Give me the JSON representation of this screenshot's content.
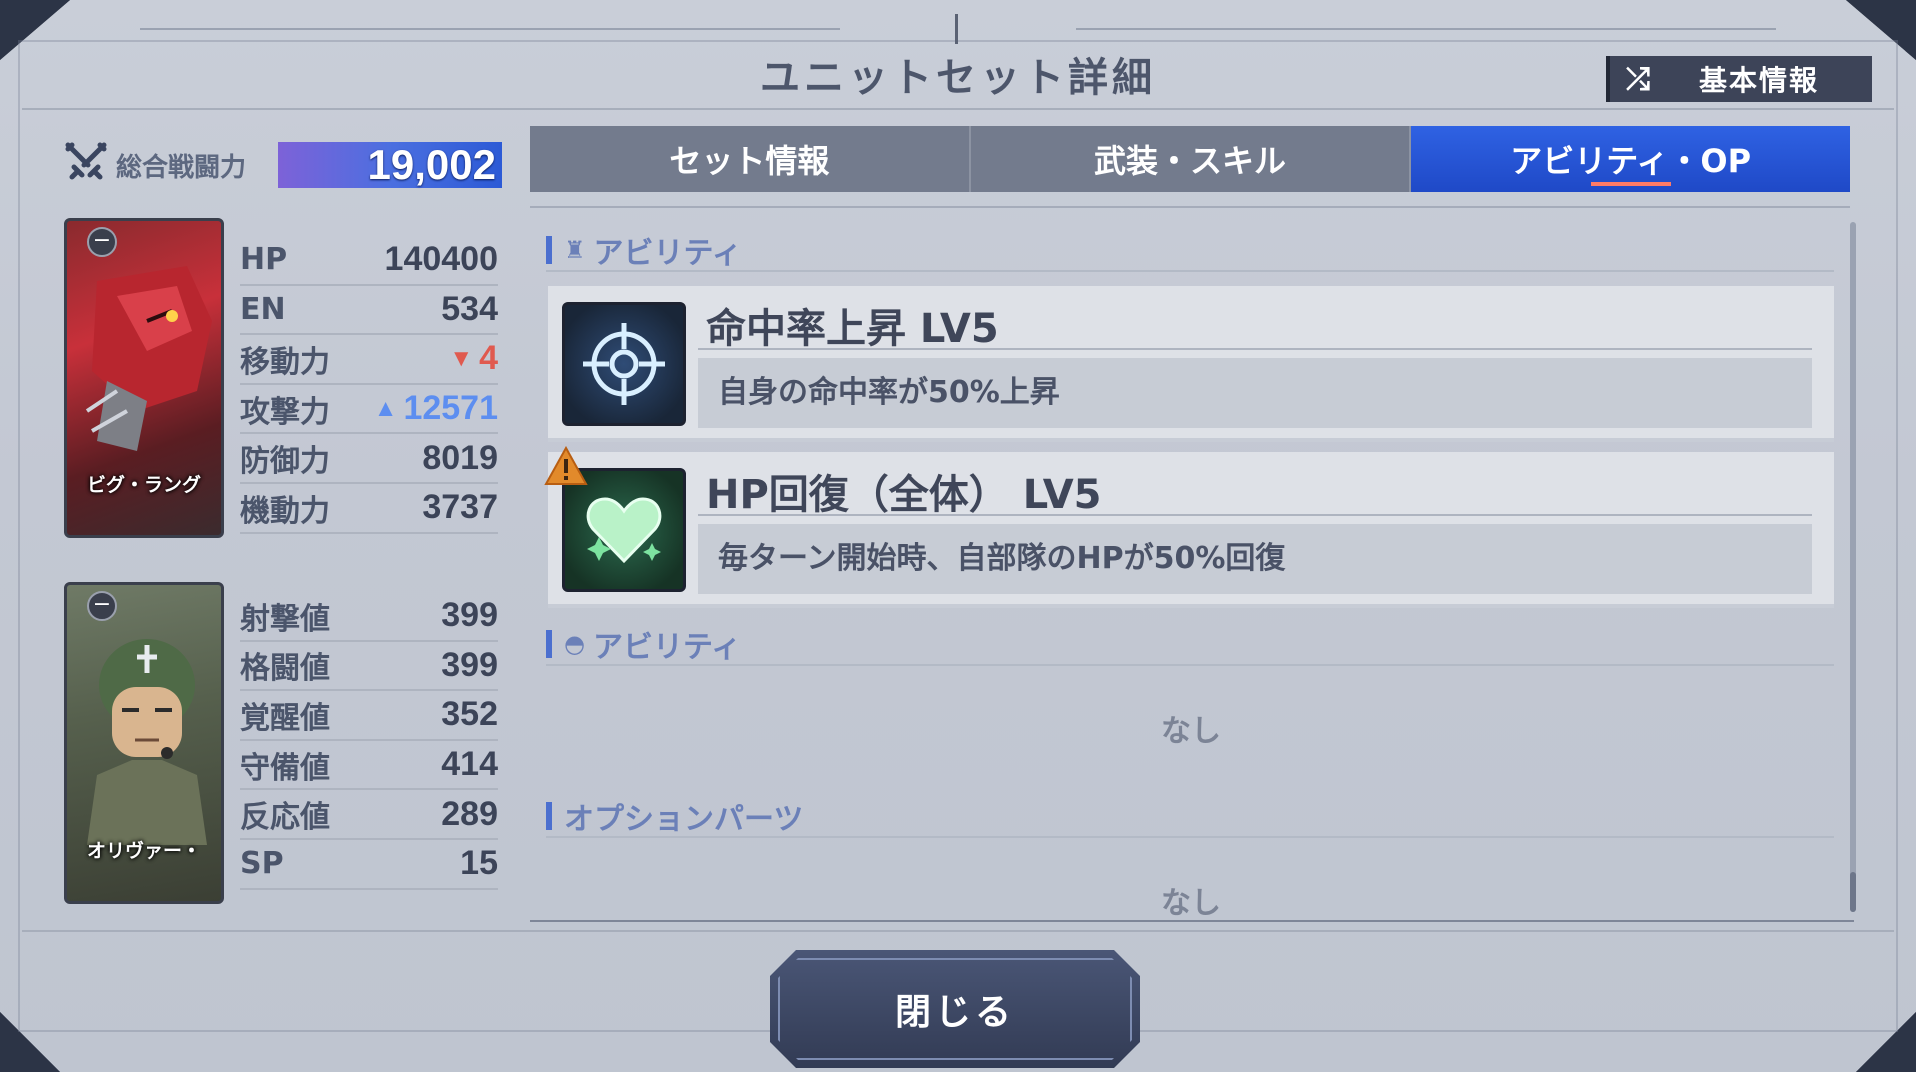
{
  "header": {
    "title": "ユニットセット詳細",
    "basic_info_label": "基本情報"
  },
  "power": {
    "label": "総合戦闘力",
    "value": "19,002"
  },
  "unit": {
    "name": "ビグ・ラング",
    "stats": [
      {
        "label": "HP",
        "value": "140400",
        "trend": "none"
      },
      {
        "label": "EN",
        "value": "534",
        "trend": "none"
      },
      {
        "label": "移動力",
        "value": "4",
        "trend": "down"
      },
      {
        "label": "攻撃力",
        "value": "12571",
        "trend": "up"
      },
      {
        "label": "防御力",
        "value": "8019",
        "trend": "none"
      },
      {
        "label": "機動力",
        "value": "3737",
        "trend": "none"
      }
    ]
  },
  "pilot": {
    "name": "オリヴァー・",
    "stats": [
      {
        "label": "射撃値",
        "value": "399"
      },
      {
        "label": "格闘値",
        "value": "399"
      },
      {
        "label": "覚醒値",
        "value": "352"
      },
      {
        "label": "守備値",
        "value": "414"
      },
      {
        "label": "反応値",
        "value": "289"
      },
      {
        "label": "SP",
        "value": "15"
      }
    ]
  },
  "tabs": [
    {
      "label": "セット情報",
      "active": false
    },
    {
      "label": "武装・スキル",
      "active": false
    },
    {
      "label": "アビリティ・OP",
      "active": true
    }
  ],
  "sections": {
    "unit_ability": {
      "title": "アビリティ",
      "items": [
        {
          "name": "命中率上昇 LV5",
          "desc": "自身の命中率が50%上昇",
          "icon": "crosshair-icon"
        },
        {
          "name": "HP回復（全体） LV5",
          "desc": "毎ターン開始時、自部隊のHPが50%回復",
          "icon": "heart-icon"
        }
      ]
    },
    "pilot_ability": {
      "title": "アビリティ",
      "none": "なし"
    },
    "option_parts": {
      "title": "オプションパーツ",
      "none": "なし"
    }
  },
  "footer": {
    "close_label": "閉じる"
  },
  "colors": {
    "accent_blue": "#2f62e3",
    "stat_down": "#e05a4f",
    "stat_up": "#5d8ef0"
  }
}
